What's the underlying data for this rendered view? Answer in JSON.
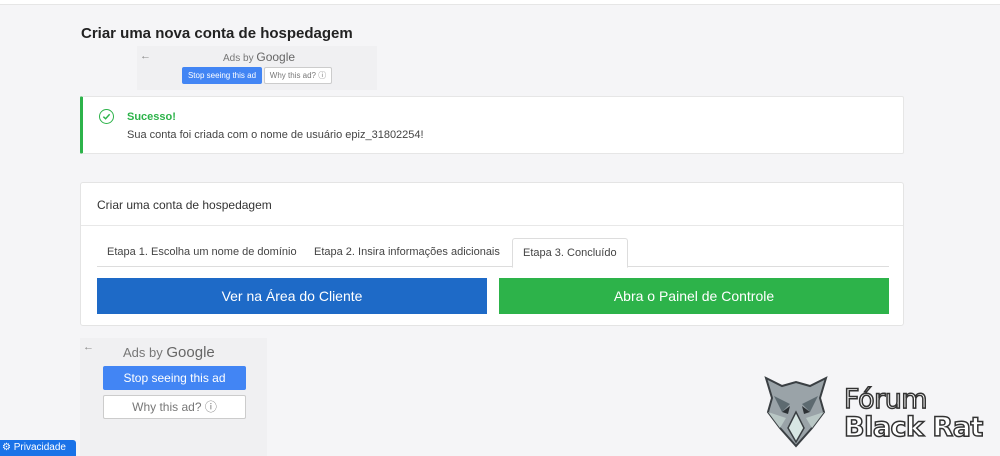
{
  "page": {
    "title": "Criar uma nova conta de hospedagem"
  },
  "ad_top": {
    "back_icon": "arrow-left-icon",
    "ads_by": "Ads by",
    "google": "Google",
    "stop_label": "Stop seeing this ad",
    "why_label": "Why this ad? ⓘ"
  },
  "alert": {
    "icon": "check-circle-icon",
    "title": "Sucesso!",
    "message": "Sua conta foi criada com o nome de usuário epiz_31802254!"
  },
  "card": {
    "title": "Criar uma conta de hospedagem",
    "tabs": [
      {
        "label": "Etapa 1. Escolha um nome de domínio"
      },
      {
        "label": "Etapa 2. Insira informações adicionais"
      },
      {
        "label": "Etapa 3. Concluído"
      }
    ],
    "client_area_label": "Ver na Área do Cliente",
    "control_panel_label": "Abra o Painel de Controle"
  },
  "ad_bottom": {
    "back_icon": "arrow-left-icon",
    "ads_by": "Ads by",
    "google": "Google",
    "stop_label": "Stop seeing this ad",
    "why_label": "Why this ad? ⓘ"
  },
  "privacy": {
    "label": "⚙ Privacidade"
  },
  "logo": {
    "line1": "Fórum",
    "line2": "Black Rat"
  },
  "colors": {
    "success": "#2db34a",
    "primary": "#1e6ac7",
    "google_blue": "#4285f4"
  }
}
